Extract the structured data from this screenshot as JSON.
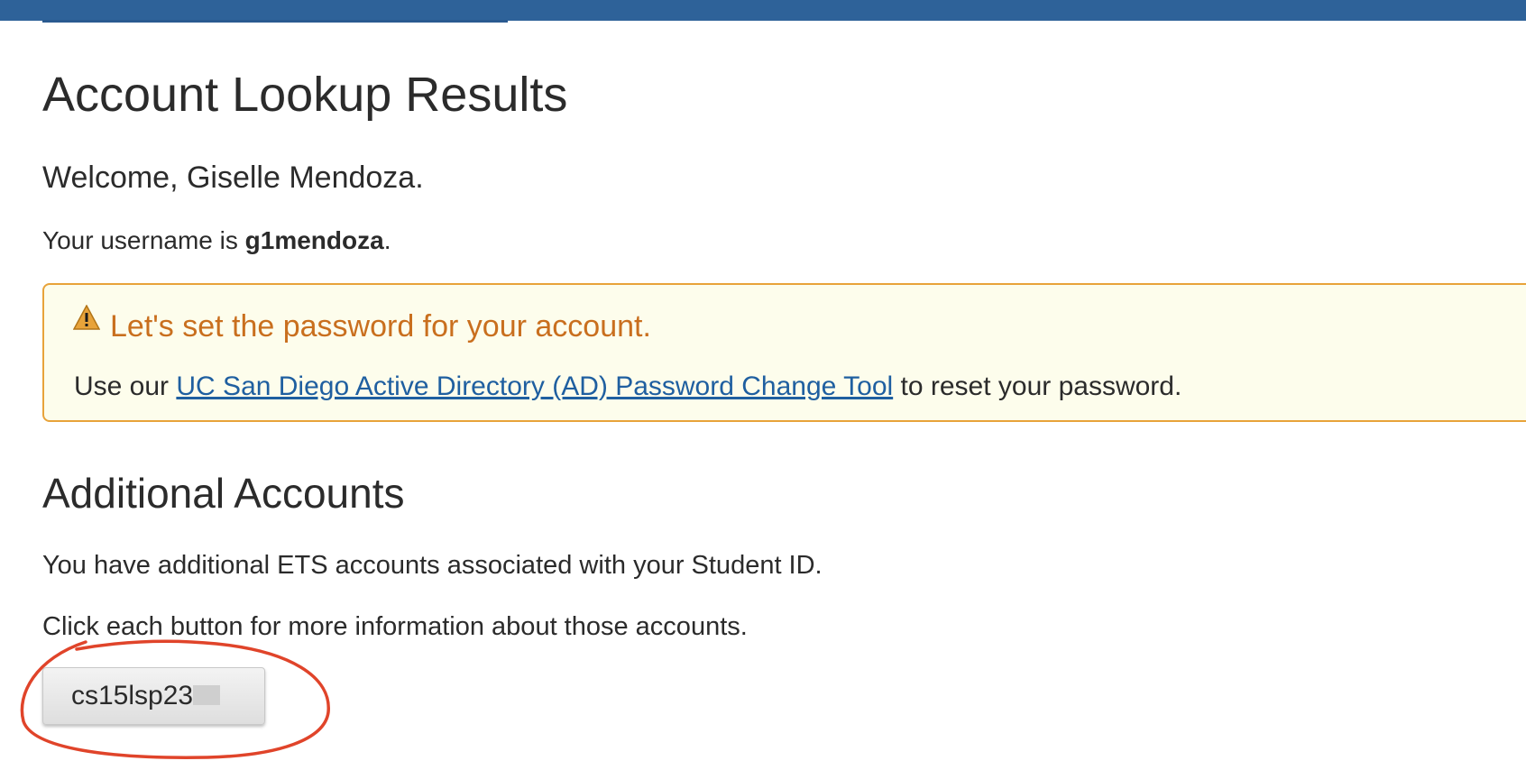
{
  "page": {
    "title": "Account Lookup Results",
    "welcome": "Welcome, Giselle Mendoza.",
    "username_prefix": "Your username is ",
    "username": "g1mendoza",
    "username_suffix": "."
  },
  "alert": {
    "icon": "warning-icon",
    "heading": "Let's set the password for your account.",
    "body_prefix": "Use our ",
    "link_text": "UC San Diego Active Directory (AD) Password Change Tool",
    "body_suffix": " to reset your password.",
    "colors": {
      "background": "#fdfdec",
      "border": "#e8a33a",
      "heading": "#c96f1e"
    }
  },
  "additional_accounts": {
    "title": "Additional Accounts",
    "description": "You have additional ETS accounts associated with your Student ID.",
    "instruction": "Click each button for more information about those accounts.",
    "buttons": [
      {
        "label": "cs15lsp23"
      }
    ]
  },
  "colors": {
    "topbar": "#2e6299",
    "link": "#1f5fa0",
    "annotation": "#e0442a"
  }
}
